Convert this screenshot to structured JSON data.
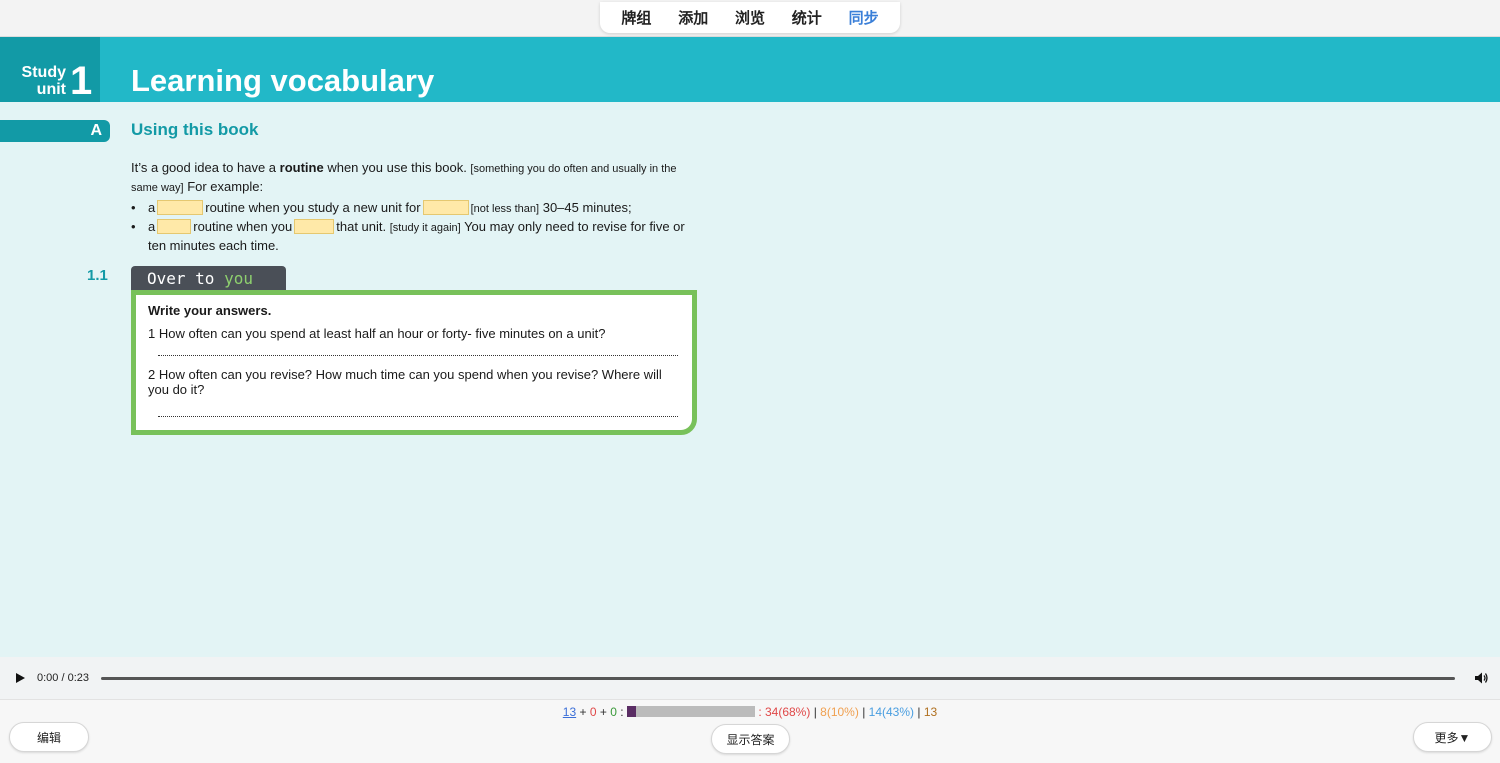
{
  "nav": {
    "tabs": [
      "牌组",
      "添加",
      "浏览",
      "统计",
      "同步"
    ],
    "active": "同步"
  },
  "card": {
    "unit_word": "Study unit",
    "unit_number": "1",
    "title": "Learning vocabulary",
    "section_letter": "A",
    "section_title": "Using this book",
    "intro_pre": "It’s a good idea to have a ",
    "intro_bold": "routine",
    "intro_post": " when you use this book. ",
    "intro_gloss": "[something you do often and usually in the same way]",
    "intro_tail": " For example:",
    "bullet1_a": "a",
    "bullet1_b": "routine when you study a new unit for",
    "bullet1_gloss": "[not less than]",
    "bullet1_c": "30–45 minutes;",
    "bullet2_a": "a",
    "bullet2_b": "routine when you",
    "bullet2_c": "that unit.",
    "bullet2_gloss": "[study it again]",
    "bullet2_d": "You may only need to revise for five or ten minutes each time.",
    "exercise_number": "1.1",
    "over_to": "Over to ",
    "over_you": "you",
    "box_heading": "Write your answers.",
    "q1": "1 How often can you spend at least half an hour or forty- five minutes on a unit?",
    "q2": "2 How often can you revise? How much time can you spend when you revise? Where will you do it?"
  },
  "audio": {
    "time": "0:00 / 0:23"
  },
  "bottom": {
    "edit_label": "编辑",
    "show_answer_label": "显示答案",
    "more_label": "更多▼",
    "stat_new": "13",
    "stat_learn": "0",
    "stat_review": "0",
    "progress_fraction": 0.07,
    "stat_red": ": 34(68%)",
    "stat_orange": "8(10%)",
    "stat_lblue": "14(43%)",
    "stat_brown": "13",
    "sep": "|",
    "plus": "+",
    "colon": ":"
  },
  "colors": {
    "banner": "#22b8c8",
    "accent_dark": "#129aa6",
    "box_green": "#78c15a",
    "background": "#e3f4f5"
  }
}
